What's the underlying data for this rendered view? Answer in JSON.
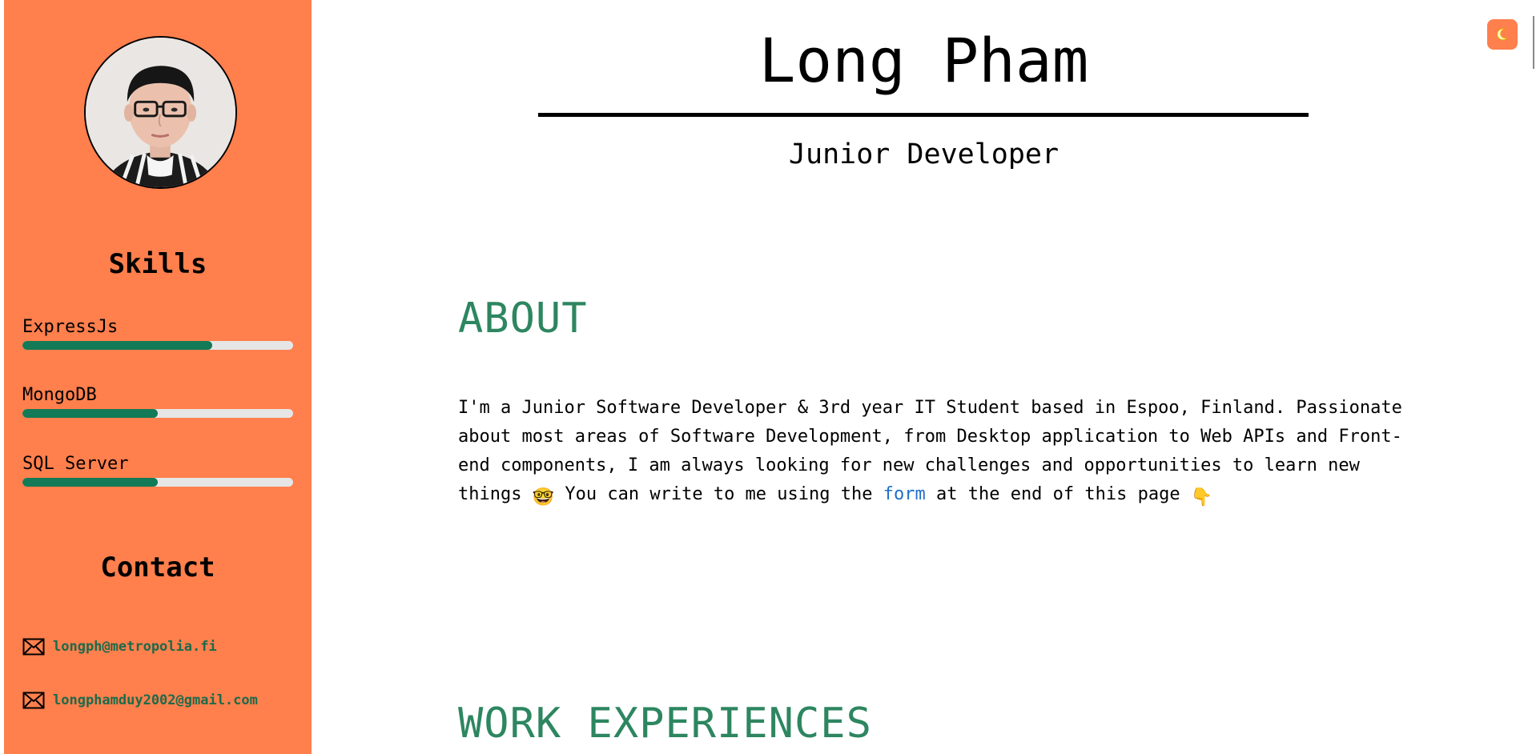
{
  "profile": {
    "name": "Long Pham",
    "job_title": "Junior Developer"
  },
  "sidebar": {
    "skills_heading": "Skills",
    "skills": [
      {
        "name": "ExpressJs",
        "level": 0.7
      },
      {
        "name": "MongoDB",
        "level": 0.5
      },
      {
        "name": "SQL Server",
        "level": 0.5
      }
    ],
    "contact_heading": "Contact",
    "contacts": [
      {
        "icon": "mail-icon",
        "email": "longph@metropolia.fi"
      },
      {
        "icon": "mail-icon",
        "email": "longphamduy2002@gmail.com"
      }
    ]
  },
  "about": {
    "heading": "ABOUT",
    "text_before": "I'm a Junior Software Developer & 3rd year IT Student based in Espoo, Finland. Passionate about most areas of Software Development, from Desktop application to Web APIs and Front-end components, I am always looking for new challenges and opportunities to learn new things",
    "emoji_1": "🤓",
    "text_middle": " You can write to me using the ",
    "link_text": "form",
    "text_after": " at the end of this page ",
    "emoji_2": "👇"
  },
  "work": {
    "heading": "WORK EXPERIENCES"
  },
  "theme_toggle": {
    "icon": "moon-icon"
  },
  "colors": {
    "sidebar_bg": "#ff7f4d",
    "skill_fill": "#137a57",
    "skill_track": "#e6e6e6",
    "section_heading": "#2d8660",
    "contact_link": "#1d6a49",
    "inline_link": "#1f6fc9"
  }
}
